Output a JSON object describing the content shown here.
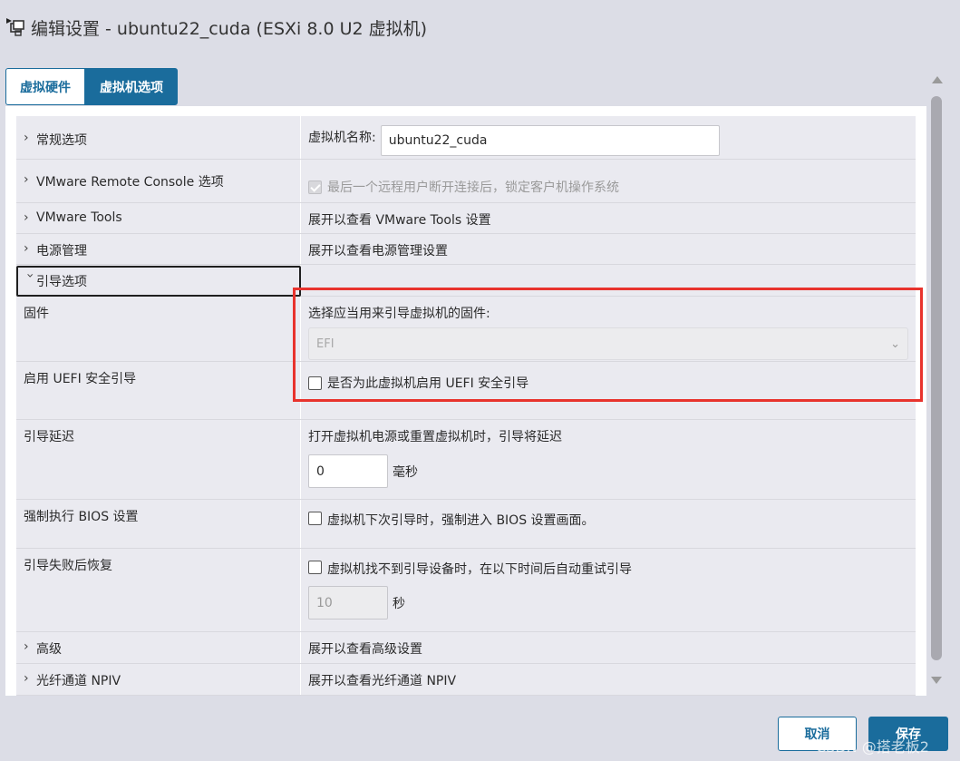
{
  "window": {
    "title": "编辑设置 - ubuntu22_cuda (ESXi 8.0 U2 虚拟机)",
    "icon": "vm-icon"
  },
  "tabs": [
    {
      "label": "虚拟硬件",
      "active": false
    },
    {
      "label": "虚拟机选项",
      "active": true
    }
  ],
  "sections": {
    "general": {
      "label": "常规选项",
      "vm_name_label": "虚拟机名称:",
      "vm_name_value": "ubuntu22_cuda"
    },
    "vmrc": {
      "label": "VMware Remote Console 选项",
      "lock_text": "最后一个远程用户断开连接后，锁定客户机操作系统"
    },
    "vmtools": {
      "label": "VMware Tools",
      "desc": "展开以查看 VMware Tools 设置"
    },
    "power": {
      "label": "电源管理",
      "desc": "展开以查看电源管理设置"
    },
    "boot": {
      "label": "引导选项",
      "firmware": {
        "label": "固件",
        "prompt": "选择应当用来引导虚拟机的固件:",
        "value": "EFI"
      },
      "secure_boot": {
        "label": "启用 UEFI 安全引导",
        "checkbox_text": "是否为此虚拟机启用 UEFI 安全引导"
      },
      "delay": {
        "label": "引导延迟",
        "desc": "打开虚拟机电源或重置虚拟机时，引导将延迟",
        "value": "0",
        "unit": "毫秒"
      },
      "bios": {
        "label": "强制执行 BIOS 设置",
        "checkbox_text": "虚拟机下次引导时，强制进入 BIOS 设置画面。"
      },
      "recovery": {
        "label": "引导失败后恢复",
        "checkbox_text": "虚拟机找不到引导设备时，在以下时间后自动重试引导",
        "value": "10",
        "unit": "秒"
      }
    },
    "advanced": {
      "label": "高级",
      "desc": "展开以查看高级设置"
    },
    "npiv": {
      "label": "光纤通道 NPIV",
      "desc": "展开以查看光纤通道 NPIV"
    }
  },
  "buttons": {
    "cancel": "取消",
    "save": "保存"
  },
  "watermark": "CSDN @搭老板2",
  "colors": {
    "accent": "#1a6c9c",
    "highlight": "#e8332d"
  }
}
